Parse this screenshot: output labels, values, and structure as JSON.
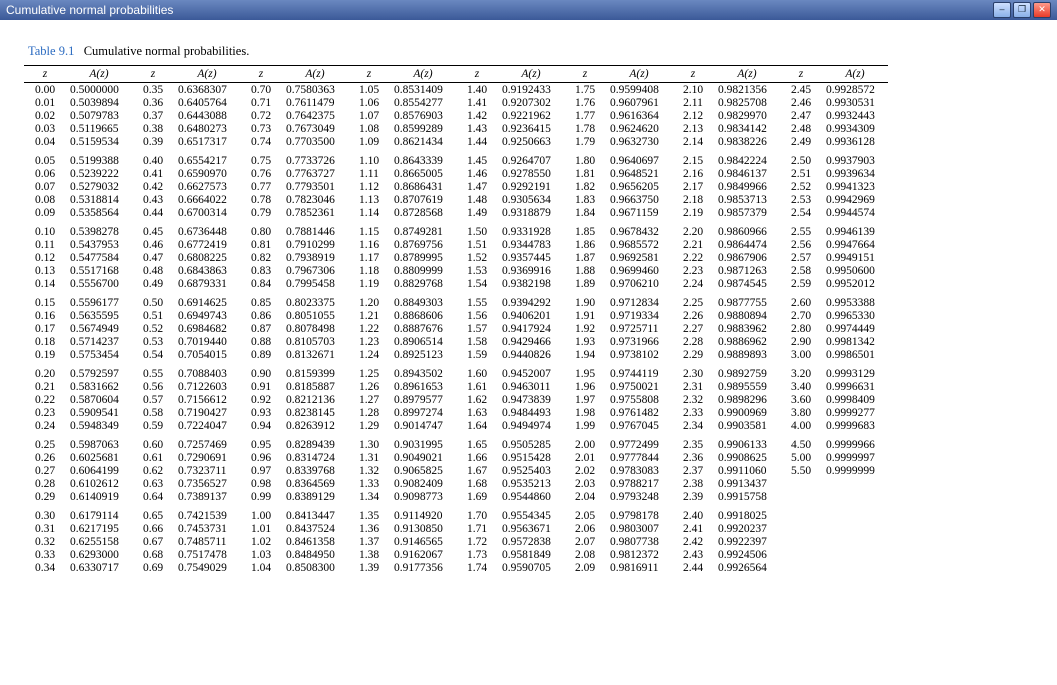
{
  "window": {
    "title": "Cumulative normal probabilities",
    "min_icon": "–",
    "max_icon": "❐",
    "close_icon": "✕"
  },
  "caption_label": "Table 9.1",
  "caption_text": "Cumulative normal probabilities.",
  "headers": {
    "z": "z",
    "a": "A(z)"
  },
  "chart_data": {
    "type": "table",
    "title": "Cumulative normal probabilities",
    "xlabel": "z",
    "ylabel": "A(z)",
    "columns": [
      {
        "z": [
          "0.00",
          "0.01",
          "0.02",
          "0.03",
          "0.04",
          "0.05",
          "0.06",
          "0.07",
          "0.08",
          "0.09",
          "0.10",
          "0.11",
          "0.12",
          "0.13",
          "0.14",
          "0.15",
          "0.16",
          "0.17",
          "0.18",
          "0.19",
          "0.20",
          "0.21",
          "0.22",
          "0.23",
          "0.24",
          "0.25",
          "0.26",
          "0.27",
          "0.28",
          "0.29",
          "0.30",
          "0.31",
          "0.32",
          "0.33",
          "0.34"
        ],
        "a": [
          "0.5000000",
          "0.5039894",
          "0.5079783",
          "0.5119665",
          "0.5159534",
          "0.5199388",
          "0.5239222",
          "0.5279032",
          "0.5318814",
          "0.5358564",
          "0.5398278",
          "0.5437953",
          "0.5477584",
          "0.5517168",
          "0.5556700",
          "0.5596177",
          "0.5635595",
          "0.5674949",
          "0.5714237",
          "0.5753454",
          "0.5792597",
          "0.5831662",
          "0.5870604",
          "0.5909541",
          "0.5948349",
          "0.5987063",
          "0.6025681",
          "0.6064199",
          "0.6102612",
          "0.6140919",
          "0.6179114",
          "0.6217195",
          "0.6255158",
          "0.6293000",
          "0.6330717"
        ]
      },
      {
        "z": [
          "0.35",
          "0.36",
          "0.37",
          "0.38",
          "0.39",
          "0.40",
          "0.41",
          "0.42",
          "0.43",
          "0.44",
          "0.45",
          "0.46",
          "0.47",
          "0.48",
          "0.49",
          "0.50",
          "0.51",
          "0.52",
          "0.53",
          "0.54",
          "0.55",
          "0.56",
          "0.57",
          "0.58",
          "0.59",
          "0.60",
          "0.61",
          "0.62",
          "0.63",
          "0.64",
          "0.65",
          "0.66",
          "0.67",
          "0.68",
          "0.69"
        ],
        "a": [
          "0.6368307",
          "0.6405764",
          "0.6443088",
          "0.6480273",
          "0.6517317",
          "0.6554217",
          "0.6590970",
          "0.6627573",
          "0.6664022",
          "0.6700314",
          "0.6736448",
          "0.6772419",
          "0.6808225",
          "0.6843863",
          "0.6879331",
          "0.6914625",
          "0.6949743",
          "0.6984682",
          "0.7019440",
          "0.7054015",
          "0.7088403",
          "0.7122603",
          "0.7156612",
          "0.7190427",
          "0.7224047",
          "0.7257469",
          "0.7290691",
          "0.7323711",
          "0.7356527",
          "0.7389137",
          "0.7421539",
          "0.7453731",
          "0.7485711",
          "0.7517478",
          "0.7549029"
        ]
      },
      {
        "z": [
          "0.70",
          "0.71",
          "0.72",
          "0.73",
          "0.74",
          "0.75",
          "0.76",
          "0.77",
          "0.78",
          "0.79",
          "0.80",
          "0.81",
          "0.82",
          "0.83",
          "0.84",
          "0.85",
          "0.86",
          "0.87",
          "0.88",
          "0.89",
          "0.90",
          "0.91",
          "0.92",
          "0.93",
          "0.94",
          "0.95",
          "0.96",
          "0.97",
          "0.98",
          "0.99",
          "1.00",
          "1.01",
          "1.02",
          "1.03",
          "1.04"
        ],
        "a": [
          "0.7580363",
          "0.7611479",
          "0.7642375",
          "0.7673049",
          "0.7703500",
          "0.7733726",
          "0.7763727",
          "0.7793501",
          "0.7823046",
          "0.7852361",
          "0.7881446",
          "0.7910299",
          "0.7938919",
          "0.7967306",
          "0.7995458",
          "0.8023375",
          "0.8051055",
          "0.8078498",
          "0.8105703",
          "0.8132671",
          "0.8159399",
          "0.8185887",
          "0.8212136",
          "0.8238145",
          "0.8263912",
          "0.8289439",
          "0.8314724",
          "0.8339768",
          "0.8364569",
          "0.8389129",
          "0.8413447",
          "0.8437524",
          "0.8461358",
          "0.8484950",
          "0.8508300"
        ]
      },
      {
        "z": [
          "1.05",
          "1.06",
          "1.07",
          "1.08",
          "1.09",
          "1.10",
          "1.11",
          "1.12",
          "1.13",
          "1.14",
          "1.15",
          "1.16",
          "1.17",
          "1.18",
          "1.19",
          "1.20",
          "1.21",
          "1.22",
          "1.23",
          "1.24",
          "1.25",
          "1.26",
          "1.27",
          "1.28",
          "1.29",
          "1.30",
          "1.31",
          "1.32",
          "1.33",
          "1.34",
          "1.35",
          "1.36",
          "1.37",
          "1.38",
          "1.39"
        ],
        "a": [
          "0.8531409",
          "0.8554277",
          "0.8576903",
          "0.8599289",
          "0.8621434",
          "0.8643339",
          "0.8665005",
          "0.8686431",
          "0.8707619",
          "0.8728568",
          "0.8749281",
          "0.8769756",
          "0.8789995",
          "0.8809999",
          "0.8829768",
          "0.8849303",
          "0.8868606",
          "0.8887676",
          "0.8906514",
          "0.8925123",
          "0.8943502",
          "0.8961653",
          "0.8979577",
          "0.8997274",
          "0.9014747",
          "0.9031995",
          "0.9049021",
          "0.9065825",
          "0.9082409",
          "0.9098773",
          "0.9114920",
          "0.9130850",
          "0.9146565",
          "0.9162067",
          "0.9177356"
        ]
      },
      {
        "z": [
          "1.40",
          "1.41",
          "1.42",
          "1.43",
          "1.44",
          "1.45",
          "1.46",
          "1.47",
          "1.48",
          "1.49",
          "1.50",
          "1.51",
          "1.52",
          "1.53",
          "1.54",
          "1.55",
          "1.56",
          "1.57",
          "1.58",
          "1.59",
          "1.60",
          "1.61",
          "1.62",
          "1.63",
          "1.64",
          "1.65",
          "1.66",
          "1.67",
          "1.68",
          "1.69",
          "1.70",
          "1.71",
          "1.72",
          "1.73",
          "1.74"
        ],
        "a": [
          "0.9192433",
          "0.9207302",
          "0.9221962",
          "0.9236415",
          "0.9250663",
          "0.9264707",
          "0.9278550",
          "0.9292191",
          "0.9305634",
          "0.9318879",
          "0.9331928",
          "0.9344783",
          "0.9357445",
          "0.9369916",
          "0.9382198",
          "0.9394292",
          "0.9406201",
          "0.9417924",
          "0.9429466",
          "0.9440826",
          "0.9452007",
          "0.9463011",
          "0.9473839",
          "0.9484493",
          "0.9494974",
          "0.9505285",
          "0.9515428",
          "0.9525403",
          "0.9535213",
          "0.9544860",
          "0.9554345",
          "0.9563671",
          "0.9572838",
          "0.9581849",
          "0.9590705"
        ]
      },
      {
        "z": [
          "1.75",
          "1.76",
          "1.77",
          "1.78",
          "1.79",
          "1.80",
          "1.81",
          "1.82",
          "1.83",
          "1.84",
          "1.85",
          "1.86",
          "1.87",
          "1.88",
          "1.89",
          "1.90",
          "1.91",
          "1.92",
          "1.93",
          "1.94",
          "1.95",
          "1.96",
          "1.97",
          "1.98",
          "1.99",
          "2.00",
          "2.01",
          "2.02",
          "2.03",
          "2.04",
          "2.05",
          "2.06",
          "2.07",
          "2.08",
          "2.09"
        ],
        "a": [
          "0.9599408",
          "0.9607961",
          "0.9616364",
          "0.9624620",
          "0.9632730",
          "0.9640697",
          "0.9648521",
          "0.9656205",
          "0.9663750",
          "0.9671159",
          "0.9678432",
          "0.9685572",
          "0.9692581",
          "0.9699460",
          "0.9706210",
          "0.9712834",
          "0.9719334",
          "0.9725711",
          "0.9731966",
          "0.9738102",
          "0.9744119",
          "0.9750021",
          "0.9755808",
          "0.9761482",
          "0.9767045",
          "0.9772499",
          "0.9777844",
          "0.9783083",
          "0.9788217",
          "0.9793248",
          "0.9798178",
          "0.9803007",
          "0.9807738",
          "0.9812372",
          "0.9816911"
        ]
      },
      {
        "z": [
          "2.10",
          "2.11",
          "2.12",
          "2.13",
          "2.14",
          "2.15",
          "2.16",
          "2.17",
          "2.18",
          "2.19",
          "2.20",
          "2.21",
          "2.22",
          "2.23",
          "2.24",
          "2.25",
          "2.26",
          "2.27",
          "2.28",
          "2.29",
          "2.30",
          "2.31",
          "2.32",
          "2.33",
          "2.34",
          "2.35",
          "2.36",
          "2.37",
          "2.38",
          "2.39",
          "2.40",
          "2.41",
          "2.42",
          "2.43",
          "2.44"
        ],
        "a": [
          "0.9821356",
          "0.9825708",
          "0.9829970",
          "0.9834142",
          "0.9838226",
          "0.9842224",
          "0.9846137",
          "0.9849966",
          "0.9853713",
          "0.9857379",
          "0.9860966",
          "0.9864474",
          "0.9867906",
          "0.9871263",
          "0.9874545",
          "0.9877755",
          "0.9880894",
          "0.9883962",
          "0.9886962",
          "0.9889893",
          "0.9892759",
          "0.9895559",
          "0.9898296",
          "0.9900969",
          "0.9903581",
          "0.9906133",
          "0.9908625",
          "0.9911060",
          "0.9913437",
          "0.9915758",
          "0.9918025",
          "0.9920237",
          "0.9922397",
          "0.9924506",
          "0.9926564"
        ]
      },
      {
        "z": [
          "2.45",
          "2.46",
          "2.47",
          "2.48",
          "2.49",
          "2.50",
          "2.51",
          "2.52",
          "2.53",
          "2.54",
          "2.55",
          "2.56",
          "2.57",
          "2.58",
          "2.59",
          "2.60",
          "2.70",
          "2.80",
          "2.90",
          "3.00",
          "3.20",
          "3.40",
          "3.60",
          "3.80",
          "4.00",
          "4.50",
          "5.00",
          "5.50"
        ],
        "a": [
          "0.9928572",
          "0.9930531",
          "0.9932443",
          "0.9934309",
          "0.9936128",
          "0.9937903",
          "0.9939634",
          "0.9941323",
          "0.9942969",
          "0.9944574",
          "0.9946139",
          "0.9947664",
          "0.9949151",
          "0.9950600",
          "0.9952012",
          "0.9953388",
          "0.9965330",
          "0.9974449",
          "0.9981342",
          "0.9986501",
          "0.9993129",
          "0.9996631",
          "0.9998409",
          "0.9999277",
          "0.9999683",
          "0.9999966",
          "0.9999997",
          "0.9999999"
        ]
      }
    ]
  }
}
